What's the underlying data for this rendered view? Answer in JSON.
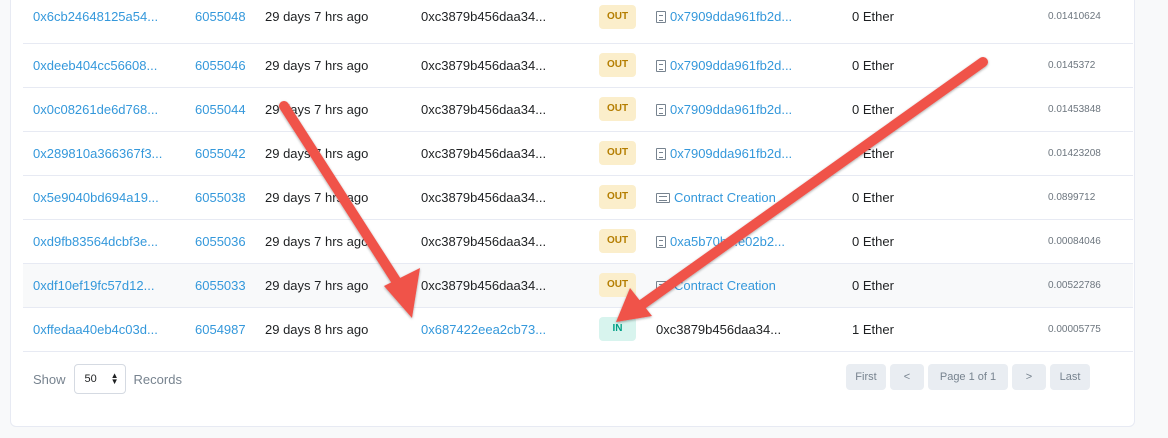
{
  "rows": [
    {
      "txn_hash": "0x6cb24648125a54...",
      "block": "6055048",
      "age": "29 days 7 hrs ago",
      "from": "0xc3879b456daa34...",
      "from_is_link": false,
      "direction": "OUT",
      "to_icon": "document-icon",
      "to": "0x7909dda961fb2d...",
      "value": "0 Ether",
      "fee": "0.01410624",
      "highlighted": false
    },
    {
      "txn_hash": "0xdeeb404cc56608...",
      "block": "6055046",
      "age": "29 days 7 hrs ago",
      "from": "0xc3879b456daa34...",
      "from_is_link": false,
      "direction": "OUT",
      "to_icon": "document-icon",
      "to": "0x7909dda961fb2d...",
      "value": "0 Ether",
      "fee": "0.0145372",
      "highlighted": false
    },
    {
      "txn_hash": "0x0c08261de6d768...",
      "block": "6055044",
      "age": "29 days 7 hrs ago",
      "from": "0xc3879b456daa34...",
      "from_is_link": false,
      "direction": "OUT",
      "to_icon": "document-icon",
      "to": "0x7909dda961fb2d...",
      "value": "0 Ether",
      "fee": "0.01453848",
      "highlighted": false
    },
    {
      "txn_hash": "0x289810a366367f3...",
      "block": "6055042",
      "age": "29 days 7 hrs ago",
      "from": "0xc3879b456daa34...",
      "from_is_link": false,
      "direction": "OUT",
      "to_icon": "document-icon",
      "to": "0x7909dda961fb2d...",
      "value": "0 Ether",
      "fee": "0.01423208",
      "highlighted": false
    },
    {
      "txn_hash": "0x5e9040bd694a19...",
      "block": "6055038",
      "age": "29 days 7 hrs ago",
      "from": "0xc3879b456daa34...",
      "from_is_link": false,
      "direction": "OUT",
      "to_icon": "contract-icon",
      "to": "Contract Creation",
      "value": "0 Ether",
      "fee": "0.0899712",
      "highlighted": false
    },
    {
      "txn_hash": "0xd9fb83564dcbf3e...",
      "block": "6055036",
      "age": "29 days 7 hrs ago",
      "from": "0xc3879b456daa34...",
      "from_is_link": false,
      "direction": "OUT",
      "to_icon": "document-icon",
      "to": "0xa5b70b...e02b2...",
      "value": "0 Ether",
      "fee": "0.00084046",
      "highlighted": false
    },
    {
      "txn_hash": "0xdf10ef19fc57d12...",
      "block": "6055033",
      "age": "29 days 7 hrs ago",
      "from": "0xc3879b456daa34...",
      "from_is_link": false,
      "direction": "OUT",
      "to_icon": "contract-icon",
      "to": "Contract Creation",
      "value": "0 Ether",
      "fee": "0.00522786",
      "highlighted": true
    },
    {
      "txn_hash": "0xffedaa40eb4c03d...",
      "block": "6054987",
      "age": "29 days 8 hrs ago",
      "from": "0x687422eea2cb73...",
      "from_is_link": true,
      "direction": "IN",
      "to_icon": "",
      "to": "0xc3879b456daa34...",
      "value": "1 Ether",
      "fee": "0.00005775",
      "highlighted": false
    }
  ],
  "footer": {
    "show_label": "Show",
    "page_size": "50",
    "records_label": "Records"
  },
  "pagination": {
    "first": "First",
    "prev": "<",
    "page_info": "Page 1 of 1",
    "next": ">",
    "last": "Last"
  },
  "colors": {
    "link": "#3498db",
    "out_badge_bg": "#fbeecb",
    "out_badge_text": "#b47d00",
    "in_badge_bg": "#d8f4ee",
    "in_badge_text": "#00a186",
    "annotation_arrow": "#f0524a"
  },
  "annotations": {
    "arrows": [
      {
        "name": "arrow-to-from-address"
      },
      {
        "name": "arrow-to-in-badge"
      }
    ]
  }
}
